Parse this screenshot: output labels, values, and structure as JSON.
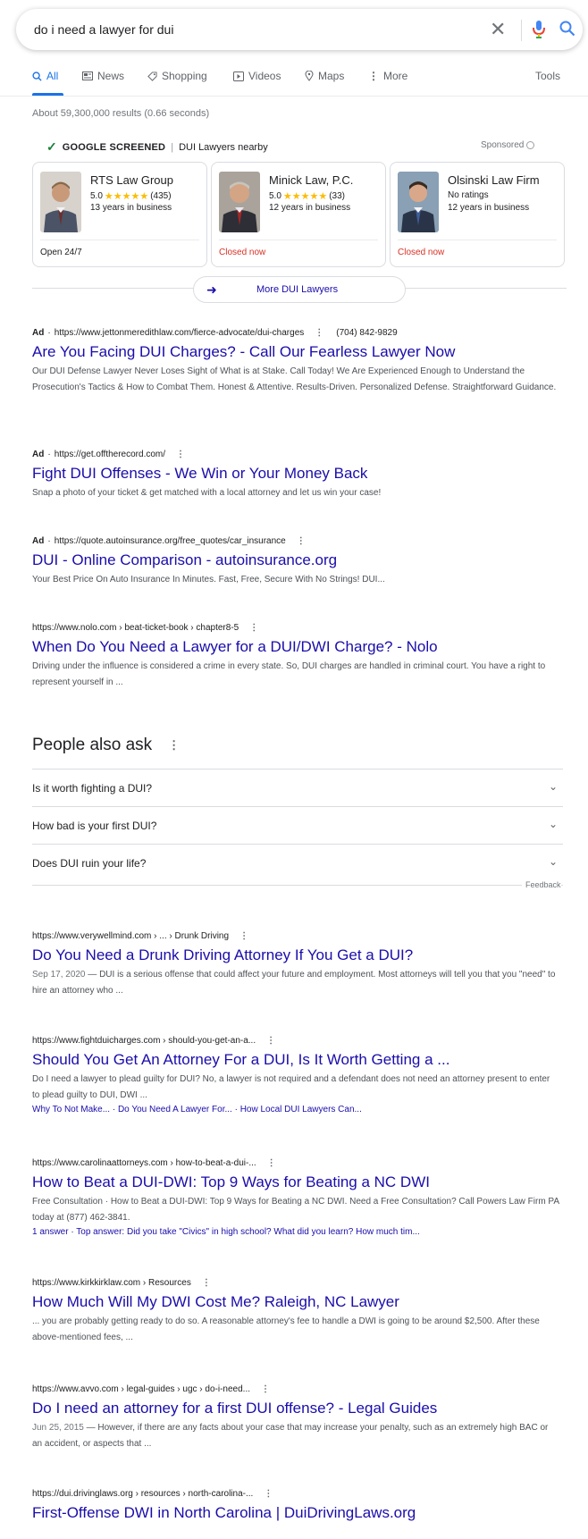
{
  "search": {
    "query": "do i need a lawyer for dui"
  },
  "tabs": [
    {
      "label": "All"
    },
    {
      "label": "News"
    },
    {
      "label": "Shopping"
    },
    {
      "label": "Videos"
    },
    {
      "label": "Maps"
    },
    {
      "label": "More"
    },
    {
      "label": "Tools"
    }
  ],
  "stats": "About 59,300,000 results (0.66 seconds)",
  "local_services": {
    "badge": "GOOGLE SCREENED",
    "subtitle": "DUI Lawyers nearby",
    "sponsored": "Sponsored",
    "more_label": "More DUI Lawyers",
    "cards": [
      {
        "name": "RTS Law Group",
        "rating": "5.0",
        "stars": "★★★★★",
        "reviews": "(435)",
        "years": "13 years in business",
        "status": "Open 24/7"
      },
      {
        "name": "Minick Law, P.C.",
        "rating": "5.0",
        "stars": "★★★★★",
        "reviews": "(33)",
        "years": "12 years in business",
        "status": "Closed now"
      },
      {
        "name": "Olsinski Law Firm",
        "rating": "No ratings",
        "stars": "",
        "reviews": "",
        "years": "12 years in business",
        "status": "Closed now"
      }
    ]
  },
  "ads": [
    {
      "label": "Ad",
      "url": "https://www.jettonmeredithlaw.com/fierce-advocate/dui-charges",
      "phone": "(704) 842-9829",
      "title": "Are You Facing DUI Charges? - Call Our Fearless Lawyer Now",
      "desc": "Our DUI Defense Lawyer Never Loses Sight of What is at Stake. Call Today! We Are Experienced Enough to Understand the Prosecution's Tactics & How to Combat Them. Honest & Attentive. Results-Driven. Personalized Defense. Straightforward Guidance."
    },
    {
      "label": "Ad",
      "url": "https://get.offtherecord.com/",
      "title": "Fight DUI Offenses - We Win or Your Money Back",
      "desc": "Snap a photo of your ticket & get matched with a local attorney and let us win your case!"
    },
    {
      "label": "Ad",
      "url": "https://quote.autoinsurance.org/free_quotes/car_insurance",
      "title": "DUI - Online Comparison - autoinsurance.org",
      "desc": "Your Best Price On Auto Insurance In Minutes. Fast, Free, Secure With No Strings! DUI..."
    }
  ],
  "result_nolo": {
    "url": "https://www.nolo.com › beat-ticket-book › chapter8-5",
    "title": "When Do You Need a Lawyer for a DUI/DWI Charge? - Nolo",
    "desc": "Driving under the influence is considered a crime in every state. So, DUI charges are handled in criminal court. You have a right to represent yourself in ..."
  },
  "paa": {
    "title": "People also ask",
    "questions": [
      "Is it worth fighting a DUI?",
      "How bad is your first DUI?",
      "Does DUI ruin your life?"
    ],
    "feedback": "Feedback"
  },
  "results": [
    {
      "url": "https://www.verywellmind.com › ... › Drunk Driving",
      "title": "Do You Need a Drunk Driving Attorney If You Get a DUI?",
      "date": "Sep 17, 2020",
      "desc": "DUI is a serious offense that could affect your future and employment. Most attorneys will tell you that you \"need\" to hire an attorney who ..."
    },
    {
      "url": "https://www.fightduicharges.com › should-you-get-an-a...",
      "title": "Should You Get An Attorney For a DUI, Is It Worth Getting a ...",
      "desc": "Do I need a lawyer to plead guilty for DUI? No, a lawyer is not required and a defendant does not need an attorney present to enter to plead guilty to DUI, DWI ...",
      "links": "Why To Not Make... · Do You Need A Lawyer For... · How Local DUI Lawyers Can..."
    },
    {
      "url": "https://www.carolinaattorneys.com › how-to-beat-a-dui-...",
      "title": "How to Beat a DUI-DWI: Top 9 Ways for Beating a NC DWI",
      "desc": "Free Consultation · How to Beat a DUI-DWI: Top 9 Ways for Beating a NC DWI. Need a Free Consultation? Call Powers Law Firm PA today at (877) 462-3841.",
      "links": "1 answer · Top answer: Did you take \"Civics\" in high school? What did you learn? How much tim..."
    },
    {
      "url": "https://www.kirkkirklaw.com › Resources",
      "title": "How Much Will My DWI Cost Me? Raleigh, NC Lawyer",
      "desc": "... you are probably getting ready to do so. A reasonable attorney's fee to handle a DWI is going to be around $2,500. After these above-mentioned fees, ..."
    },
    {
      "url": "https://www.avvo.com › legal-guides › ugc › do-i-need...",
      "title": "Do I need an attorney for a first DUI offense? - Legal Guides",
      "date": "Jun 25, 2015",
      "desc": "However, if there are any facts about your case that may increase your penalty, such as an extremely high BAC or an accident, or aspects that ..."
    },
    {
      "url": "https://dui.drivinglaws.org › resources › north-carolina-...",
      "title": "First-Offense DWI in North Carolina | DuiDrivingLaws.org"
    }
  ]
}
